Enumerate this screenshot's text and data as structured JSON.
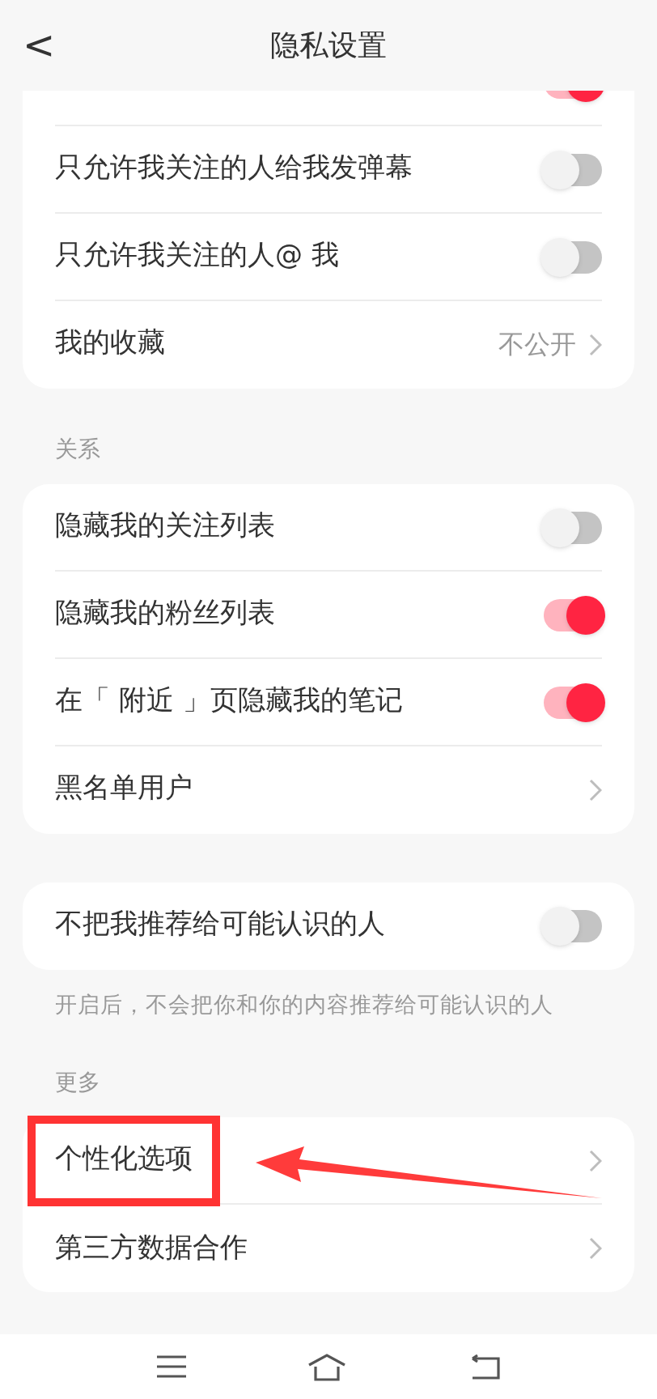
{
  "header": {
    "back": "<",
    "title": "隐私设置"
  },
  "sections": [
    {
      "rows": [
        {
          "kind": "toggle",
          "label": "",
          "on": true
        },
        {
          "kind": "toggle",
          "label": "只允许我关注的人给我发弹幕",
          "on": false
        },
        {
          "kind": "toggle",
          "label": "只允许我关注的人@ 我",
          "on": false
        },
        {
          "kind": "link",
          "label": "我的收藏",
          "value": "不公开"
        }
      ]
    },
    {
      "title": "关系",
      "rows": [
        {
          "kind": "toggle",
          "label": "隐藏我的关注列表",
          "on": false
        },
        {
          "kind": "toggle",
          "label": "隐藏我的粉丝列表",
          "on": true
        },
        {
          "kind": "toggle",
          "label": "在「 附近 」页隐藏我的笔记",
          "on": true
        },
        {
          "kind": "link",
          "label": "黑名单用户"
        }
      ]
    },
    {
      "rows": [
        {
          "kind": "toggle",
          "label": "不把我推荐给可能认识的人",
          "on": false
        }
      ],
      "note": "开启后，不会把你和你的内容推荐给可能认识的人"
    },
    {
      "title": "更多",
      "rows": [
        {
          "kind": "link",
          "label": "个性化选项",
          "highlighted": true
        },
        {
          "kind": "link",
          "label": "第三方数据合作"
        }
      ]
    }
  ]
}
